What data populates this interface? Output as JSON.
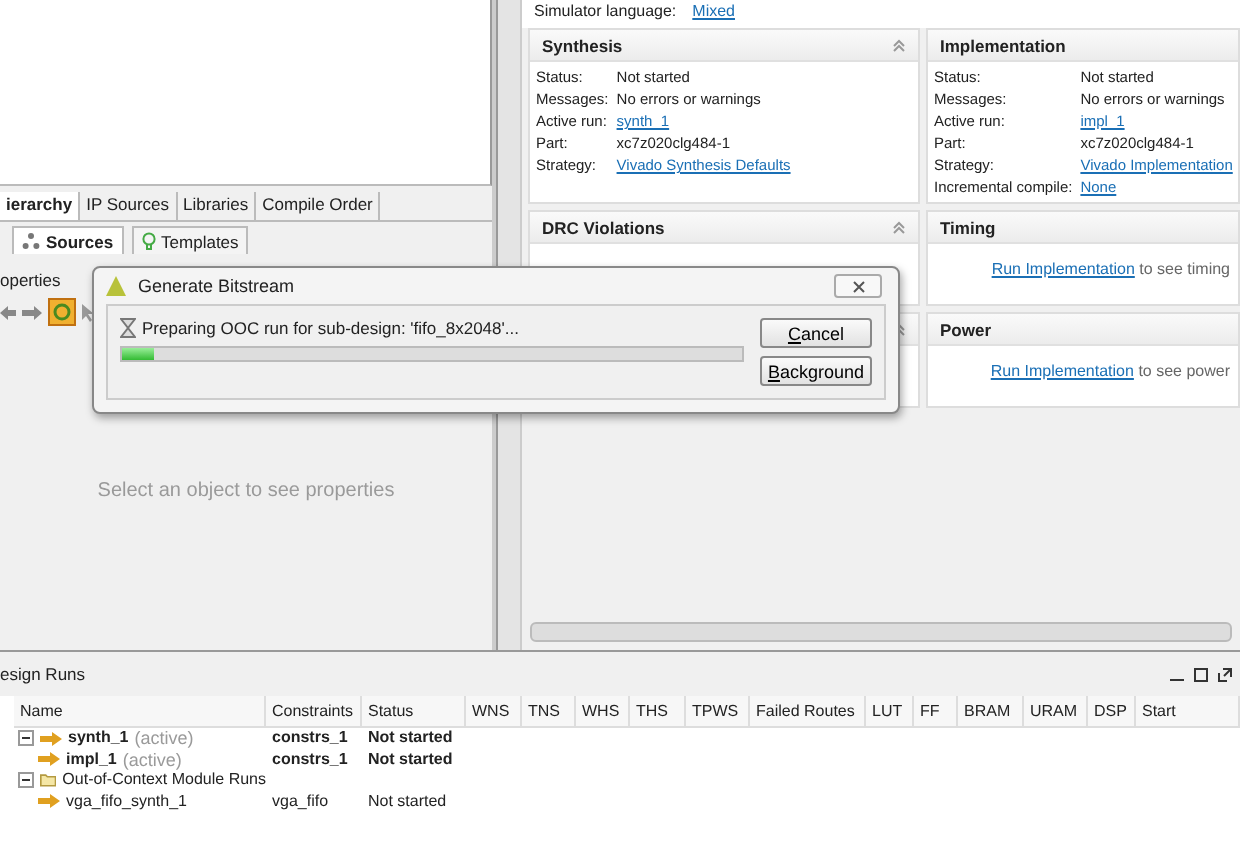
{
  "left_panel": {
    "tabs": [
      {
        "label": "ierarchy",
        "selected": true
      },
      {
        "label": "IP Sources",
        "selected": false
      },
      {
        "label": "Libraries",
        "selected": false
      },
      {
        "label": "Compile Order",
        "selected": false
      }
    ],
    "view_tabs": [
      {
        "label": "Sources",
        "selected": true,
        "kind": "hierarchy"
      },
      {
        "label": "Templates",
        "selected": false,
        "kind": "bulb"
      }
    ],
    "properties": {
      "title": "operties",
      "empty_message": "Select an object to see properties"
    }
  },
  "project_summary": {
    "simulator_language": {
      "label": "Simulator language:",
      "value": "Mixed"
    },
    "cards": [
      {
        "title": "Synthesis",
        "collapsible": true,
        "rows": [
          {
            "label": "Status:",
            "value": "Not started",
            "kind": "text"
          },
          {
            "label": "Messages:",
            "value": "No errors or warnings",
            "kind": "text"
          },
          {
            "label": "Active run:",
            "value": "synth_1",
            "kind": "link"
          },
          {
            "label": "Part:",
            "value": "xc7z020clg484-1",
            "kind": "text"
          },
          {
            "label": "Strategy:",
            "value": "Vivado Synthesis Defaults",
            "kind": "link"
          }
        ]
      },
      {
        "title": "Implementation",
        "collapsible": false,
        "rows": [
          {
            "label": "Status:",
            "value": "Not started",
            "kind": "text"
          },
          {
            "label": "Messages:",
            "value": "No errors or warnings",
            "kind": "text"
          },
          {
            "label": "Active run:",
            "value": "impl_1",
            "kind": "link"
          },
          {
            "label": "Part:",
            "value": "xc7z020clg484-1",
            "kind": "text"
          },
          {
            "label": "Strategy:",
            "value": "Vivado Implementation",
            "kind": "link"
          },
          {
            "label": "Incremental compile:",
            "value": "None",
            "kind": "link"
          }
        ]
      },
      {
        "title": "DRC Violations",
        "collapsible": true
      },
      {
        "title": "Timing",
        "collapsible": false,
        "message": {
          "link": "Run Implementation",
          "text": "to see timing"
        }
      },
      {
        "collapsible": true
      },
      {
        "title": "Power",
        "collapsible": false,
        "message": {
          "link": "Run Implementation",
          "text": "to see power"
        }
      }
    ]
  },
  "dialog": {
    "title": "Generate Bitstream",
    "message": "Preparing OOC run for sub-design: 'fifo_8x2048'...",
    "level": 0.05,
    "buttons": [
      "Cancel",
      "Background"
    ]
  },
  "design_runs": {
    "title": "esign Runs",
    "columns": [
      "Name",
      "Constraints",
      "Status",
      "WNS",
      "TNS",
      "WHS",
      "THS",
      "TPWS",
      "Failed Routes",
      "LUT",
      "FF",
      "BRAM",
      "URAM",
      "DSP",
      "Start"
    ],
    "rows": [
      {
        "kind": "run",
        "name": "synth_1",
        "note": "(active)",
        "constraints": "constrs_1",
        "status": "Not started",
        "bold": true,
        "expanded": true,
        "children": [
          {
            "kind": "run",
            "name": "impl_1",
            "note": "(active)",
            "constraints": "constrs_1",
            "status": "Not started",
            "bold": true
          }
        ]
      },
      {
        "kind": "folder",
        "name": "Out-of-Context Module Runs",
        "expanded": true,
        "children": [
          {
            "kind": "run",
            "name": "vga_fifo_synth_1",
            "constraints": "vga_fifo",
            "status": "Not started",
            "bold": false
          }
        ]
      }
    ]
  }
}
